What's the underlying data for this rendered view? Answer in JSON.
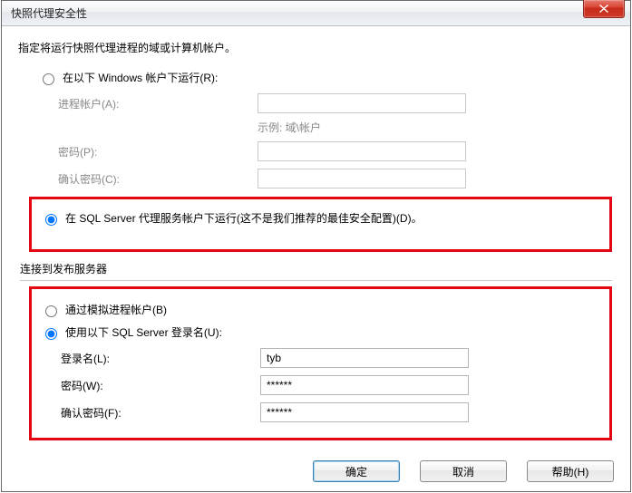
{
  "window": {
    "title": "快照代理安全性"
  },
  "intro": "指定将运行快照代理进程的域或计算机帐户。",
  "section1": {
    "radio_windows": "在以下 Windows 帐户下运行(R):",
    "process_account_label": "进程帐户(A):",
    "process_account_value": "",
    "example": "示例: 域\\帐户",
    "password_label": "密码(P):",
    "password_value": "",
    "confirm_label": "确认密码(C):",
    "confirm_value": "",
    "radio_sqlagent": "在 SQL Server 代理服务帐户下运行(这不是我们推荐的最佳安全配置)(D)。"
  },
  "section2": {
    "header": "连接到发布服务器",
    "radio_impersonate": "通过模拟进程帐户(B)",
    "radio_sqllogin": "使用以下 SQL Server 登录名(U):",
    "login_label": "登录名(L):",
    "login_value": "tyb",
    "password_label": "密码(W):",
    "password_value": "******",
    "confirm_label": "确认密码(F):",
    "confirm_value": "******"
  },
  "buttons": {
    "ok": "确定",
    "cancel": "取消",
    "help": "帮助(H)"
  }
}
